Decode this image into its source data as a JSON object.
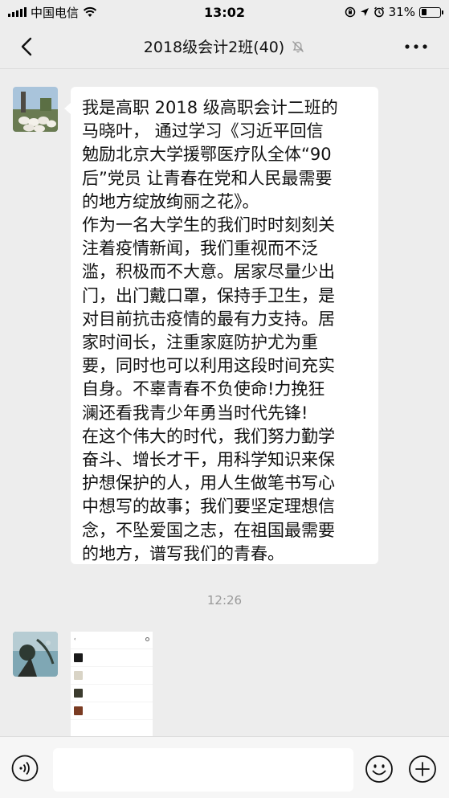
{
  "status_bar": {
    "carrier": "中国电信",
    "time": "13:02",
    "battery_percent": "31%",
    "battery_level": 0.31
  },
  "header": {
    "title": "2018级会计2班(40)"
  },
  "messages": [
    {
      "type": "text",
      "text": "我是高职 2018 级高职会计二班的\n马晓叶， 通过学习《习近平回信\n勉励北京大学援鄂医疗队全体“90\n后”党员 让青春在党和人民最需要\n的地方绽放绚丽之花》。\n作为一名大学生的我们时时刻刻关\n注着疫情新闻，我们重视而不泛\n滥，积极而不大意。居家尽量少出\n门，出门戴口罩，保持手卫生，是\n对目前抗击疫情的最有力支持。居\n家时间长，注重家庭防护尤为重\n要，同时也可以利用这段时间充实\n自身。不辜青春不负使命!力挽狂\n澜还看我青少年勇当时代先锋!\n在这个伟大的时代，我们努力勤学\n奋斗、增长才干，用科学知识来保\n护想保护的人，用人生做笔书写心\n中想写的故事；我们要坚定理想信\n念，不坠爱国之志，在祖国最需要\n的地方，谱写我们的青春。"
    },
    {
      "type": "time",
      "text": "12:26"
    },
    {
      "type": "image"
    }
  ],
  "colors": {
    "background": "#ededed",
    "bubble": "#ffffff",
    "timestamp": "#9a9a9a"
  },
  "icons": [
    "signal-icon",
    "wifi-icon",
    "lock-rotation-icon",
    "location-icon",
    "alarm-icon",
    "battery-icon",
    "back-arrow-icon",
    "mute-bell-icon",
    "more-icon",
    "voice-icon",
    "emoji-icon",
    "plus-icon"
  ]
}
